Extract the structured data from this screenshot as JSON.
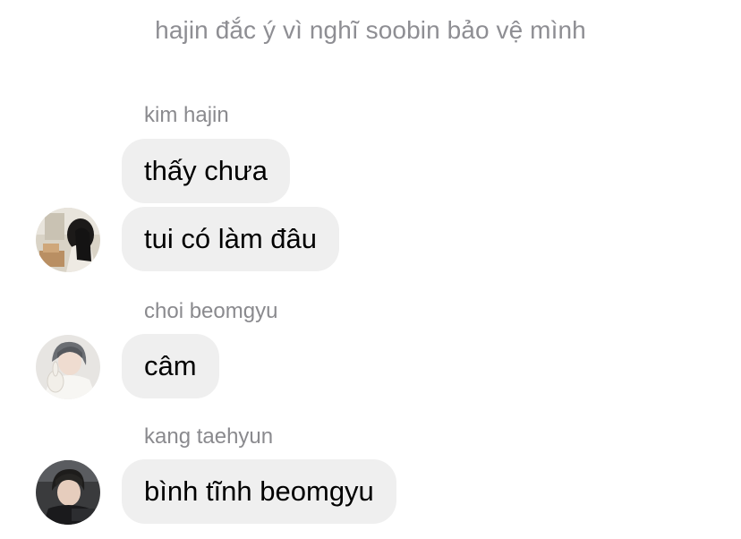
{
  "chat": {
    "system_note": "hajin đắc ý vì nghĩ soobin bảo vệ mình",
    "groups": [
      {
        "sender": "kim hajin",
        "messages": [
          "thấy chưa",
          "tui có làm đâu"
        ]
      },
      {
        "sender": "choi beomgyu",
        "messages": [
          "câm"
        ]
      },
      {
        "sender": "kang taehyun",
        "messages": [
          "bình tĩnh beomgyu"
        ]
      }
    ]
  }
}
